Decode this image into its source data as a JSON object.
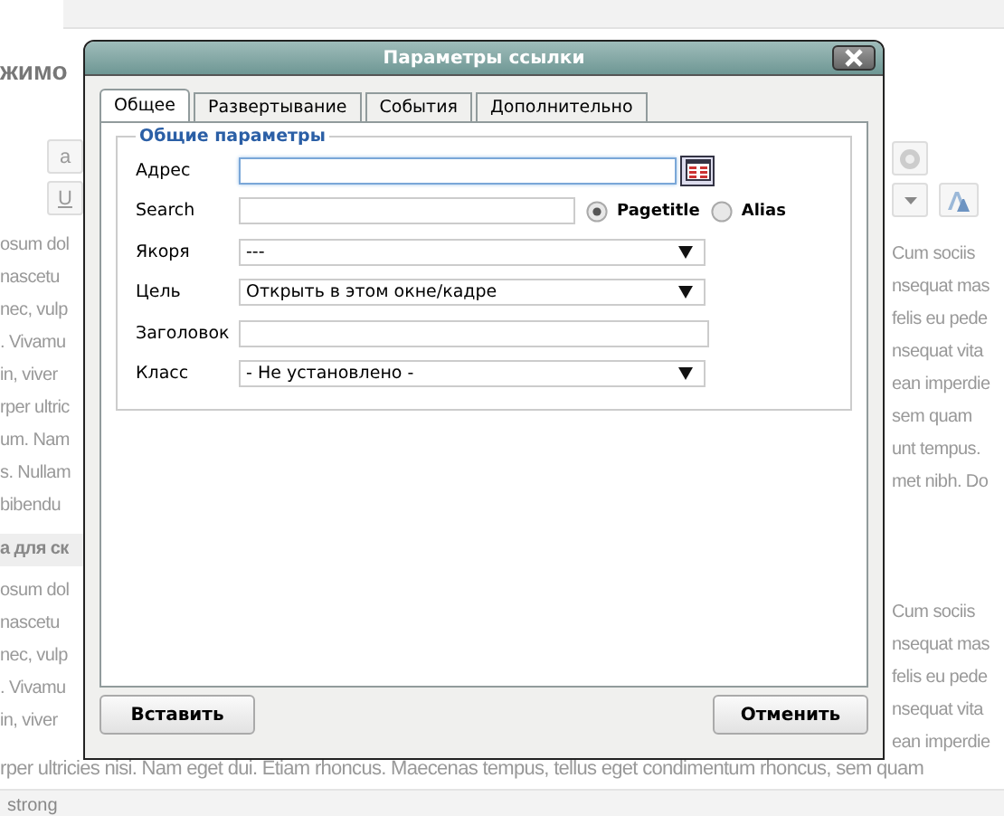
{
  "background": {
    "heading": "жимо",
    "left_tools": [
      "a",
      "U"
    ],
    "left_lines": [
      "osum dol",
      "nascetu",
      "nec, vulp",
      ". Vivamu",
      "in, viver",
      "rper ultric",
      "um. Nam",
      "s. Nullam",
      "bibendu"
    ],
    "section_heading": "а для ск",
    "left_lines_2": [
      "osum dol",
      "nascetu",
      "nec, vulp",
      ". Vivamu",
      "in, viver"
    ],
    "right_lines": [
      "Cum sociis",
      "nsequat mas",
      "felis eu pede",
      "nsequat vita",
      "ean imperdie",
      "sem quam",
      "unt tempus.",
      "met nibh. Do"
    ],
    "right_lines_2": [
      "Cum sociis",
      "nsequat mas",
      "felis eu pede",
      "nsequat vita",
      "ean imperdie"
    ],
    "bottom_line": "rper ultricies nisi. Nam eget dui. Etiam rhoncus. Maecenas tempus, tellus eget condimentum rhoncus, sem quam",
    "status_path": "strong"
  },
  "dialog": {
    "title": "Параметры ссылки",
    "tabs": [
      {
        "label": "Общее",
        "selected": true
      },
      {
        "label": "Развертывание",
        "selected": false
      },
      {
        "label": "События",
        "selected": false
      },
      {
        "label": "Дополнительно",
        "selected": false
      }
    ],
    "legend": "Общие параметры",
    "rows": [
      {
        "kind": "browse",
        "label": "Адрес",
        "focused": true
      },
      {
        "kind": "search",
        "label": "Search",
        "options": [
          {
            "label": "Pagetitle",
            "selected": true
          },
          {
            "label": "Alias",
            "selected": false
          }
        ]
      },
      {
        "kind": "select",
        "label": "Якоря",
        "value": "---"
      },
      {
        "kind": "select",
        "label": "Цель",
        "value": "Открыть в этом окне/кадре"
      },
      {
        "kind": "text",
        "label": "Заголовок",
        "focused": false
      },
      {
        "kind": "select",
        "label": "Класс",
        "value": "- Не установлено -"
      }
    ],
    "buttons": [
      "Вставить",
      "Отменить"
    ]
  }
}
